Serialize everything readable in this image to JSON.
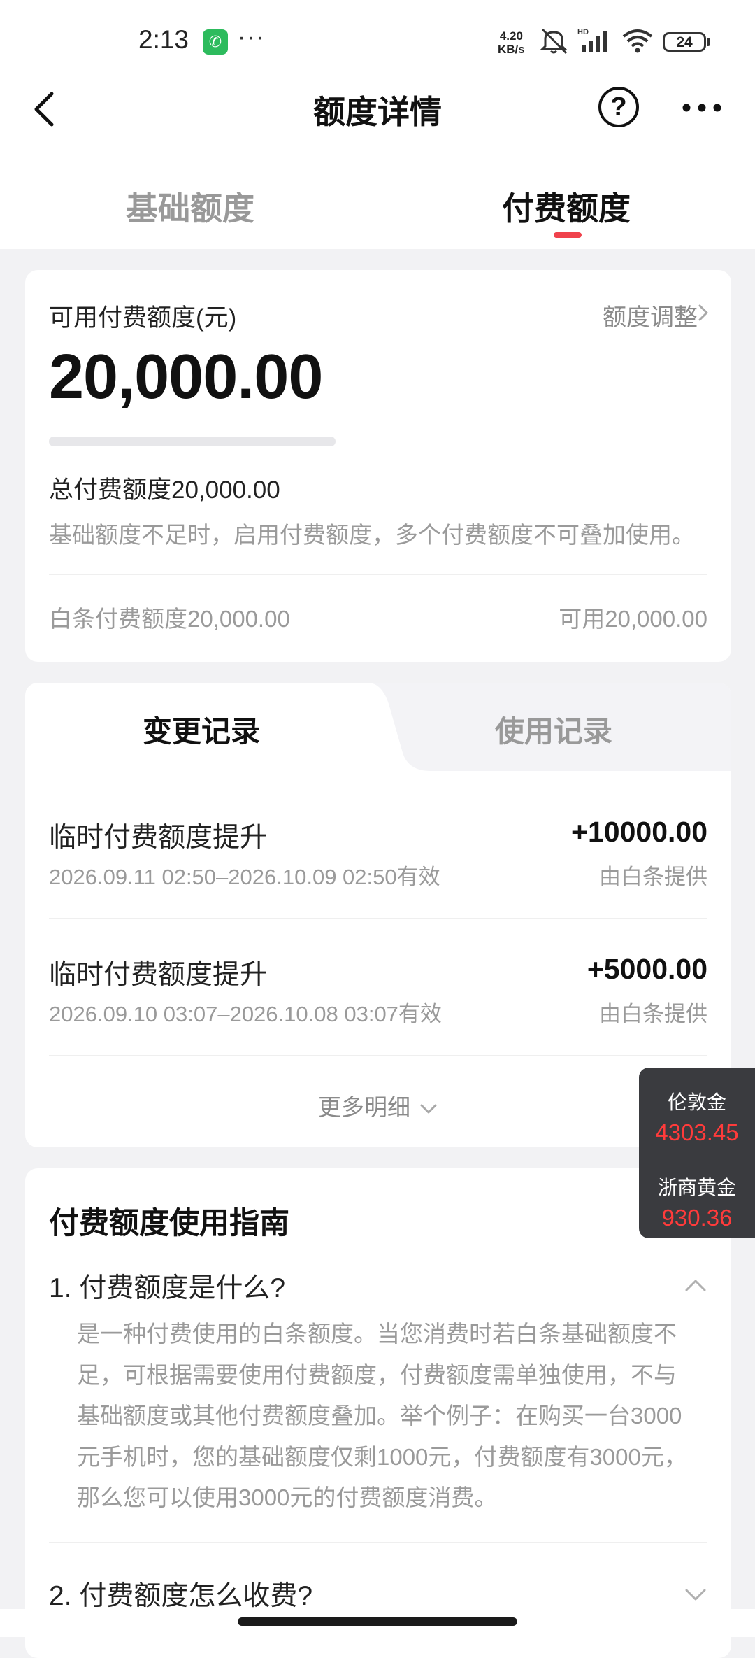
{
  "status_bar": {
    "time": "2:13",
    "dots": "···",
    "net_speed_value": "4.20",
    "net_speed_unit": "KB/s",
    "battery": "24",
    "icons": [
      "phone-call-icon",
      "mute-icon",
      "hd-signal-icon",
      "wifi-icon",
      "battery-icon"
    ]
  },
  "nav": {
    "title": "额度详情",
    "back_icon": "chevron-left-icon",
    "help_icon": "question-circle-icon",
    "help_glyph": "?",
    "more_icon": "more-dots-icon"
  },
  "top_tabs": [
    {
      "label": "基础额度",
      "active": false
    },
    {
      "label": "付费额度",
      "active": true
    }
  ],
  "accent_color": "#f0424c",
  "quota_card": {
    "label": "可用付费额度(元)",
    "adjust_label": "额度调整",
    "amount": "20,000.00",
    "used_fraction": 0,
    "total_text": "总付费额度20,000.00",
    "description": "基础额度不足时，启用付费额度，多个付费额度不可叠加使用。",
    "baitiao_text": "白条付费额度20,000.00",
    "available_text": "可用20,000.00"
  },
  "records_card": {
    "tabs": [
      {
        "label": "变更记录",
        "active": true
      },
      {
        "label": "使用记录",
        "active": false
      }
    ],
    "records": [
      {
        "title": "临时付费额度提升",
        "amount": "+10000.00",
        "validity": "2026.09.11 02:50–2026.10.09 02:50有效",
        "source": "由白条提供"
      },
      {
        "title": "临时付费额度提升",
        "amount": "+5000.00",
        "validity": "2026.09.10 03:07–2026.10.08 03:07有效",
        "source": "由白条提供"
      }
    ],
    "more_label": "更多明细"
  },
  "guide_card": {
    "title": "付费额度使用指南",
    "faqs": [
      {
        "question": "1. 付费额度是什么?",
        "expanded": true,
        "answer_lines": [
          "是一种付费使用的白条额度。当您消费时若白条基础额度不",
          "足，可根据需要使用付费额度，付费额度需单独使用，不与",
          "基础额度或其他付费额度叠加。举个例子：在购买一台3000",
          "元手机时，您的基础额度仅剩1000元，付费额度有3000元，",
          "那么您可以使用3000元的付费额度消费。"
        ]
      },
      {
        "question": "2. 付费额度怎么收费?",
        "expanded": false
      }
    ]
  },
  "gold_widget": {
    "items": [
      {
        "name": "伦敦金",
        "price": "4303.45"
      },
      {
        "name": "浙商黄金",
        "price": "930.36"
      }
    ],
    "price_color": "#ff3b3b"
  }
}
